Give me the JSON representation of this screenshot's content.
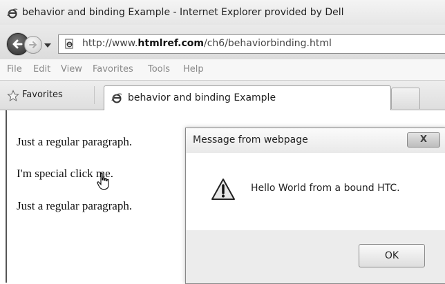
{
  "window": {
    "title": "behavior and binding Example - Internet Explorer provided by Dell",
    "icon": "ie-logo-icon"
  },
  "address_bar": {
    "url_prefix": "http://www.",
    "url_domain": "htmlref.com",
    "url_path": "/ch6/behaviorbinding.html"
  },
  "menu": {
    "items": [
      {
        "label": "File"
      },
      {
        "label": "Edit"
      },
      {
        "label": "View"
      },
      {
        "label": "Favorites"
      },
      {
        "label": "Tools"
      },
      {
        "label": "Help"
      }
    ]
  },
  "favorites_bar": {
    "label": "Favorites",
    "icon": "star-icon"
  },
  "tab": {
    "title": "behavior and binding Example"
  },
  "page": {
    "paragraphs": [
      "Just a regular paragraph.",
      "I'm special click me.",
      "Just a regular paragraph."
    ]
  },
  "dialog": {
    "title": "Message from webpage",
    "close_label": "X",
    "message": "Hello World from a bound HTC.",
    "ok_label": "OK",
    "icon": "warning-icon"
  }
}
